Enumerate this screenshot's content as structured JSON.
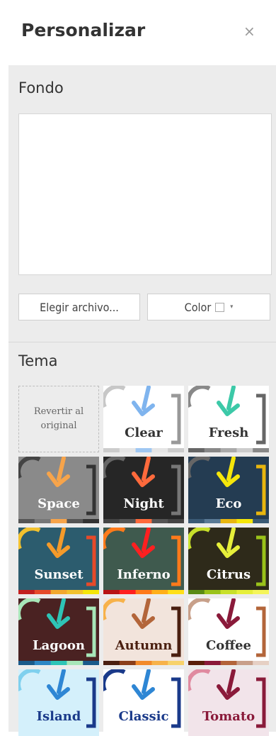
{
  "header": {
    "title": "Personalizar",
    "close_glyph": "×"
  },
  "background": {
    "title": "Fondo",
    "choose_file_label": "Elegir archivo...",
    "color_label": "Color",
    "caret_glyph": "▾"
  },
  "theme": {
    "title": "Tema",
    "revert_line1": "Revertir al",
    "revert_line2": "original",
    "themes": [
      {
        "name": "Clear",
        "bg": "#ffffff",
        "arc": "#c7c7c7",
        "arrow": "#7fb4ee",
        "bracket": "#999999",
        "text": "#333333",
        "strip": [
          "#cccccc",
          "#e5e5e5",
          "#9fc7f2",
          "#e5e5e5",
          "#cccccc"
        ]
      },
      {
        "name": "Fresh",
        "bg": "#ffffff",
        "arc": "#888888",
        "arrow": "#3cc9a8",
        "bracket": "#666666",
        "text": "#333333",
        "strip": [
          "#666666",
          "#888888",
          "#aaaaaa",
          "#cccccc",
          "#888888"
        ]
      },
      {
        "name": "Space",
        "bg": "#8a8a8a",
        "arc": "#444444",
        "arrow": "#f7a44a",
        "bracket": "#333333",
        "text": "#ffffff",
        "strip": [
          "#555555",
          "#777777",
          "#f7a44a",
          "#555555",
          "#333333"
        ]
      },
      {
        "name": "Night",
        "bg": "#262626",
        "arc": "#666666",
        "arrow": "#ff6a3c",
        "bracket": "#777777",
        "text": "#ffffff",
        "strip": [
          "#444444",
          "#555555",
          "#ff6a3c",
          "#555555",
          "#444444"
        ]
      },
      {
        "name": "Eco",
        "bg": "#243c52",
        "arc": "#666666",
        "arrow": "#f5e60a",
        "bracket": "#e8b60f",
        "text": "#ffffff",
        "strip": [
          "#3a5a75",
          "#5a7a95",
          "#e8b60f",
          "#f5e60a",
          "#3a5a75"
        ]
      },
      {
        "name": "Sunset",
        "bg": "#2c5c6e",
        "arc": "#f2c12e",
        "arrow": "#f49a2a",
        "bracket": "#e64a2a",
        "text": "#ffffff",
        "strip": [
          "#c21f1f",
          "#e64a2a",
          "#f2a72e",
          "#f2c12e",
          "#f5e60a"
        ]
      },
      {
        "name": "Inferno",
        "bg": "#3f5a4e",
        "arc": "#ff7a1a",
        "arrow": "#ff2020",
        "bracket": "#ff7a1a",
        "text": "#ffffff",
        "strip": [
          "#b81414",
          "#ff2020",
          "#ff7a1a",
          "#ffb01a",
          "#ffe01a"
        ]
      },
      {
        "name": "Citrus",
        "bg": "#2e2a1a",
        "arc": "#c8e02a",
        "arrow": "#e6ef3a",
        "bracket": "#9ac21a",
        "text": "#ffffff",
        "strip": [
          "#5a8a14",
          "#9ac21a",
          "#c8e02a",
          "#e6ef3a",
          "#f5f55a"
        ]
      },
      {
        "name": "Lagoon",
        "bg": "#4a2222",
        "arc": "#a8e6b8",
        "arrow": "#2ec4b6",
        "bracket": "#a8e6b8",
        "text": "#ffffff",
        "strip": [
          "#1a5a8a",
          "#2e86c4",
          "#2ec4b6",
          "#a8e6b8",
          "#1a5a8a"
        ]
      },
      {
        "name": "Autumn",
        "bg": "#f2e4dc",
        "arc": "#f7b24a",
        "arrow": "#b3653a",
        "bracket": "#4a1f10",
        "text": "#4a1f10",
        "strip": [
          "#4a1f10",
          "#8a3e1a",
          "#f28a2a",
          "#f7b24a",
          "#f7d26a"
        ]
      },
      {
        "name": "Coffee",
        "bg": "#ffffff",
        "arc": "#c8a08a",
        "arrow": "#8a1a3a",
        "bracket": "#b3653a",
        "text": "#333333",
        "strip": [
          "#5a1f0a",
          "#8a1a3a",
          "#b3653a",
          "#c8a08a",
          "#e6d0c4"
        ]
      },
      {
        "name": "Island",
        "bg": "#d4f0fb",
        "arc": "#7fd0ee",
        "arrow": "#2e86d4",
        "bracket": "#1a3a8a",
        "text": "#1a3a8a",
        "strip": []
      },
      {
        "name": "Classic",
        "bg": "#ffffff",
        "arc": "#1a3a8a",
        "arrow": "#2e86d4",
        "bracket": "#1a3a8a",
        "text": "#1a3a8a",
        "strip": []
      },
      {
        "name": "Tomato",
        "bg": "#f2e4ea",
        "arc": "#e08aa0",
        "arrow": "#8a1a3a",
        "bracket": "#8a1a3a",
        "text": "#8a1a3a",
        "strip": []
      }
    ]
  }
}
